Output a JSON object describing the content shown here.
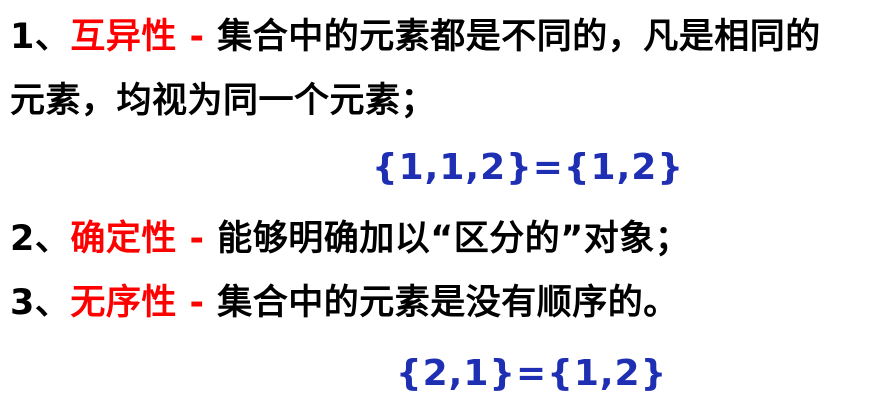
{
  "items": [
    {
      "number": "1、",
      "keyword": "互异性 - ",
      "description_line1": "集合中的元素都是不同的，凡是相同的",
      "description_line2": "元素，均视为同一个元素；",
      "formula": "{1,1,2}={1,2}"
    },
    {
      "number": "2、",
      "keyword": "确定性 - ",
      "description_line1": "能够明确加以“区分的”对象；"
    },
    {
      "number": "3、",
      "keyword": "无序性 - ",
      "description_line1": "集合中的元素是没有顺序的。",
      "formula": "{2,1}={1,2}"
    }
  ],
  "colors": {
    "text": "#000000",
    "keyword": "#ff0000",
    "formula": "#1f2fb3",
    "background": "#ffffff"
  }
}
